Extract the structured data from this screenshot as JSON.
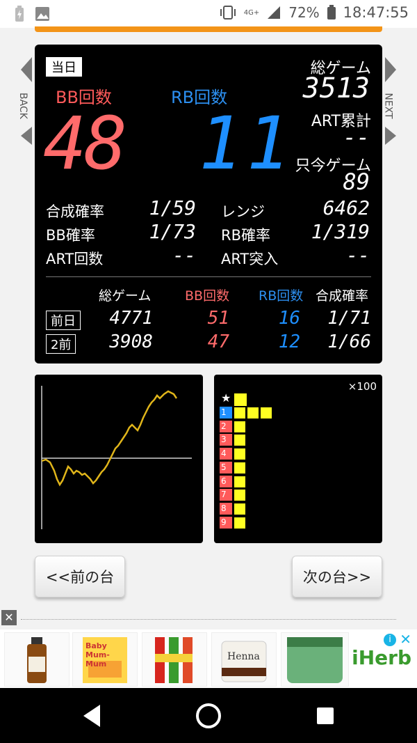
{
  "status_bar": {
    "network": "4G+",
    "battery": "72%",
    "time": "18:47:55"
  },
  "side": {
    "back": "BACK",
    "next": "NEXT"
  },
  "panel": {
    "today_label": "当日",
    "bb_label": "BB回数",
    "rb_label": "RB回数",
    "bb_count": "48",
    "rb_count": "11",
    "total_games_label": "総ゲーム",
    "total_games": "3513",
    "art_total_label": "ART累計",
    "art_total": "--",
    "current_game_label": "只今ゲーム",
    "current_game": "89",
    "combined_rate_label": "合成確率",
    "combined_rate": "1/59",
    "range_label": "レンジ",
    "range": "6462",
    "bb_rate_label": "BB確率",
    "bb_rate": "1/73",
    "rb_rate_label": "RB確率",
    "rb_rate": "1/319",
    "art_count_label": "ART回数",
    "art_count": "--",
    "art_entry_label": "ART突入",
    "art_entry": "--"
  },
  "history": {
    "headers": [
      "総ゲーム",
      "BB回数",
      "RB回数",
      "合成確率"
    ],
    "rows": [
      {
        "label": "前日",
        "games": "4771",
        "bb": "51",
        "rb": "16",
        "rate": "1/71"
      },
      {
        "label": "2前",
        "games": "3908",
        "bb": "47",
        "rb": "12",
        "rate": "1/66"
      }
    ]
  },
  "bar_panel": {
    "multiplier": "×100",
    "star": "★",
    "rows": [
      "1",
      "2",
      "3",
      "4",
      "5",
      "6",
      "7",
      "8",
      "9"
    ],
    "first_row_blocks": 3
  },
  "buttons": {
    "prev": "<<前の台",
    "next": "次の台>>"
  },
  "ad": {
    "close": "✕",
    "brand": "iHerb",
    "x": "✕",
    "items": [
      "Oil",
      "Baby Mum-Mum",
      "Lip Balm",
      "Henna",
      "Sugar Scrub"
    ]
  },
  "colors": {
    "bb": "#ff6b6b",
    "rb": "#1e8fff",
    "accent": "#f39418"
  }
}
